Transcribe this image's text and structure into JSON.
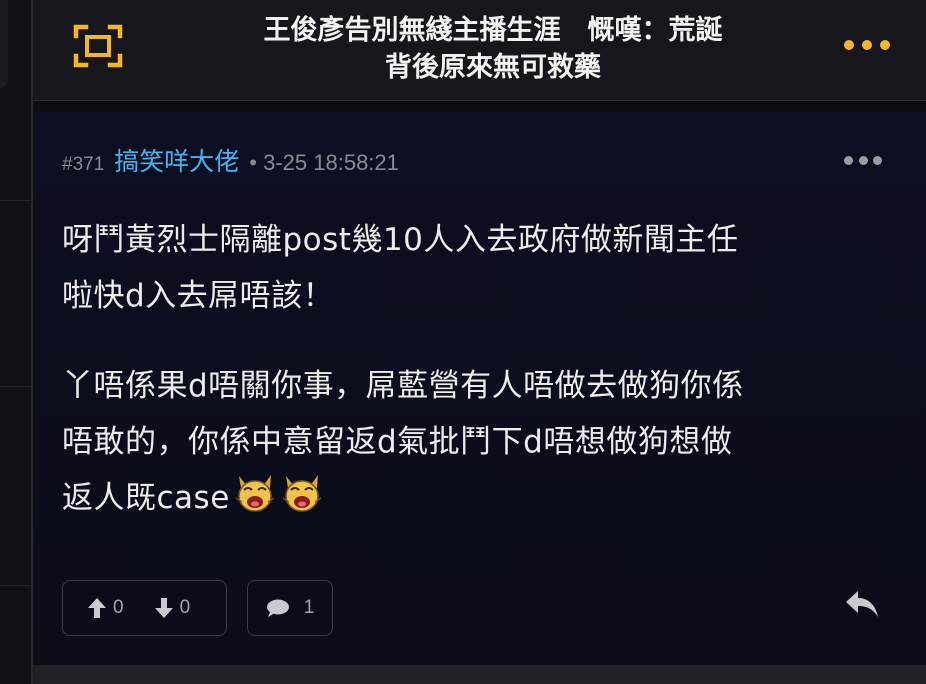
{
  "header": {
    "title_line1": "王俊彥告別無綫主播生涯　慨嘆：荒誕",
    "title_line2": "背後原來無可救藥",
    "accent_color": "#f5b52b",
    "left_icon": "fullscreen-frame-icon",
    "right_icon": "more-dots-icon"
  },
  "post": {
    "number": "#371",
    "username": "搞笑咩大佬",
    "timestamp": "• 3-25 18:58:21",
    "paragraph1_line1": "呀鬥黃烈士隔離post幾10人入去政府做新聞主任",
    "paragraph1_line2": "啦快d入去屌唔該！",
    "paragraph2_line1": "丫唔係果d唔關你事，屌藍營有人唔做去做狗你係",
    "paragraph2_line2": "唔敢的，你係中意留返d氣批鬥下d唔想做狗想做",
    "paragraph2_line3": "返人既case",
    "emoji_icon": "laughing-cat-emoji-icon",
    "upvotes": "0",
    "downvotes": "0",
    "comments": "1",
    "username_color": "#46b2f0"
  }
}
